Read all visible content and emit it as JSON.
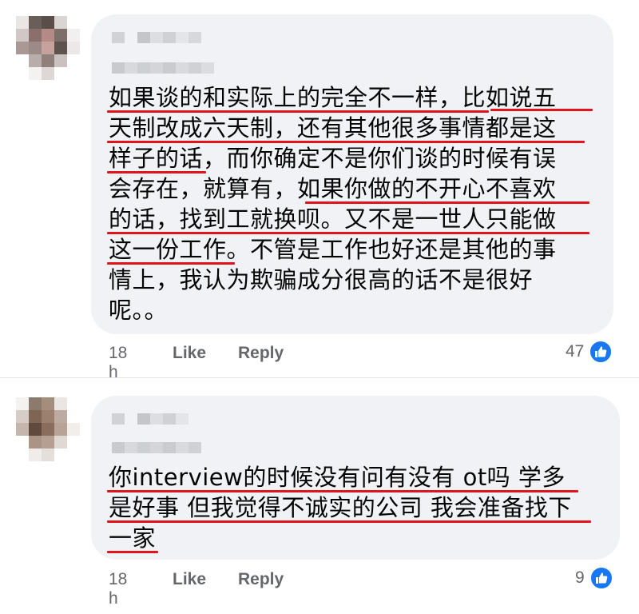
{
  "comments": [
    {
      "lines": [
        "如果谈的和实际上的完全不一样，比如说五",
        "天制改成六天制，还有其他很多事情都是这",
        "样子的话，而你确定不是你们谈的时候有误",
        "会存在，就算有，如果你做的不开心不喜欢",
        "的话，找到工就换呗。又不是一世人只能做",
        "这一份工作。不管是工作也好还是其他的事",
        "情上，我认为欺骗成分很高的话不是很好",
        "呢。。"
      ],
      "time": "18 h",
      "like_label": "Like",
      "reply_label": "Reply",
      "reaction_count": "47",
      "reaction_icon": "thumbs-up-icon"
    },
    {
      "lines": [
        "你interview的时候没有问有没有 ot吗 学多",
        "是好事 但我觉得不诚实的公司 我会准备找下",
        "一家"
      ],
      "time": "18 h",
      "like_label": "Like",
      "reply_label": "Reply",
      "reaction_count": "9",
      "reaction_icon": "thumbs-up-icon"
    }
  ],
  "colors": {
    "bubble": "#f0f2f5",
    "underline": "#e0131e",
    "meta_text": "#65676b",
    "like_icon": "#1877f2"
  }
}
